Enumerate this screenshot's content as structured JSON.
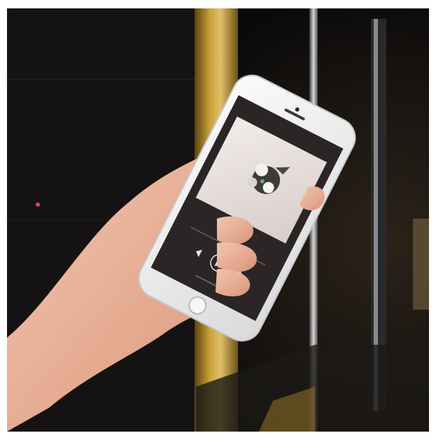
{
  "photo": {
    "description_free": true
  },
  "player": {
    "header_line1": "",
    "header_line2": "",
    "track_title": "",
    "track_artist": "",
    "footer_text": ""
  },
  "colors": {
    "background_dark": "#0d0c0c",
    "brass_pillar": "#b8902c",
    "phone_body": "#f4f4f4",
    "screen_dark": "#2b2625",
    "album_bg": "#e9e2e0",
    "skin": "#e9b7a0"
  },
  "icons": [
    "play-pause-icon",
    "previous-icon",
    "next-icon",
    "home-button-icon"
  ]
}
